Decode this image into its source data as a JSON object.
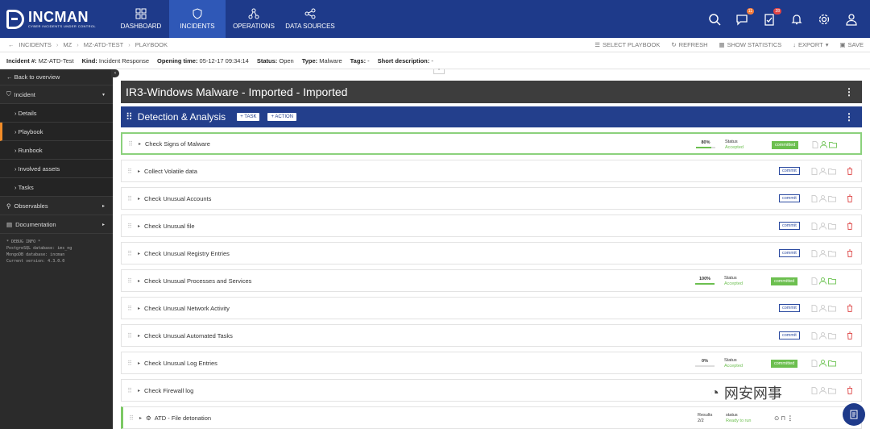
{
  "brand": {
    "name": "INCMAN",
    "tagline": "CYBER INCIDENTS UNDER CONTROL"
  },
  "nav": [
    {
      "label": "DASHBOARD",
      "icon": "dashboard-icon"
    },
    {
      "label": "INCIDENTS",
      "icon": "shield-icon",
      "active": true
    },
    {
      "label": "OPERATIONS",
      "icon": "operations-icon"
    },
    {
      "label": "DATA SOURCES",
      "icon": "share-icon"
    }
  ],
  "top_icons": {
    "chat_badge": "11",
    "tasks_badge": "28"
  },
  "breadcrumb": [
    "INCIDENTS",
    "MZ",
    "MZ-ATD-TEST",
    "PLAYBOOK"
  ],
  "actions": {
    "select_playbook": "SELECT PLAYBOOK",
    "refresh": "REFRESH",
    "show_statistics": "SHOW STATISTICS",
    "export": "EXPORT",
    "save": "SAVE"
  },
  "info": {
    "incident_label": "Incident #:",
    "incident_value": "MZ-ATD-Test",
    "kind_label": "Kind:",
    "kind_value": "Incident Response",
    "opening_label": "Opening time:",
    "opening_value": "05-12-17 09:34:14",
    "status_label": "Status:",
    "status_value": "Open",
    "type_label": "Type:",
    "type_value": "Malware",
    "tags_label": "Tags:",
    "tags_value": "-",
    "desc_label": "Short description:",
    "desc_value": "-"
  },
  "sidebar": {
    "back": "Back to overview",
    "incident": "Incident",
    "items": [
      "Details",
      "Playbook",
      "Runbook",
      "Involved assets",
      "Tasks"
    ],
    "observables": "Observables",
    "documentation": "Documentation",
    "debug": [
      "* DEBUG INFO *",
      "PostgreSQL database: ims_ng",
      "MongoDB database: incman",
      "Current version: 4.3.0.0"
    ]
  },
  "playbook": {
    "title": "IR3-Windows Malware - Imported - Imported",
    "section": "Detection & Analysis",
    "task_btn": "TASK",
    "action_btn": "ACTION"
  },
  "tasks": [
    {
      "name": "Check Signs of Malware",
      "progress": "80%",
      "progress_value": 80,
      "status_label": "Status",
      "status_value": "Accepted",
      "button": "committed"
    },
    {
      "name": "Collect Volatile data",
      "button": "commit"
    },
    {
      "name": "Check Unusual Accounts",
      "button": "commit"
    },
    {
      "name": "Check Unusual file",
      "button": "commit"
    },
    {
      "name": "Check Unusual Registry Entries",
      "button": "commit"
    },
    {
      "name": "Check Unusual Processes and Services",
      "progress": "100%",
      "progress_value": 100,
      "status_label": "Status",
      "status_value": "Accepted",
      "button": "committed"
    },
    {
      "name": "Check Unusual Network Activity",
      "button": "commit"
    },
    {
      "name": "Check Unusual Automated Tasks",
      "button": "commit"
    },
    {
      "name": "Check Unusual Log Entries",
      "progress": "0%",
      "progress_value": 0,
      "status_label": "Status",
      "status_value": "Accepted",
      "button": "committed"
    },
    {
      "name": "Check Firewall log"
    },
    {
      "name": "ATD - File detonation",
      "results_label": "Results",
      "results_value": "2/2",
      "status_label": "status",
      "status_value": "Ready to run"
    }
  ],
  "watermark": "网安网事"
}
